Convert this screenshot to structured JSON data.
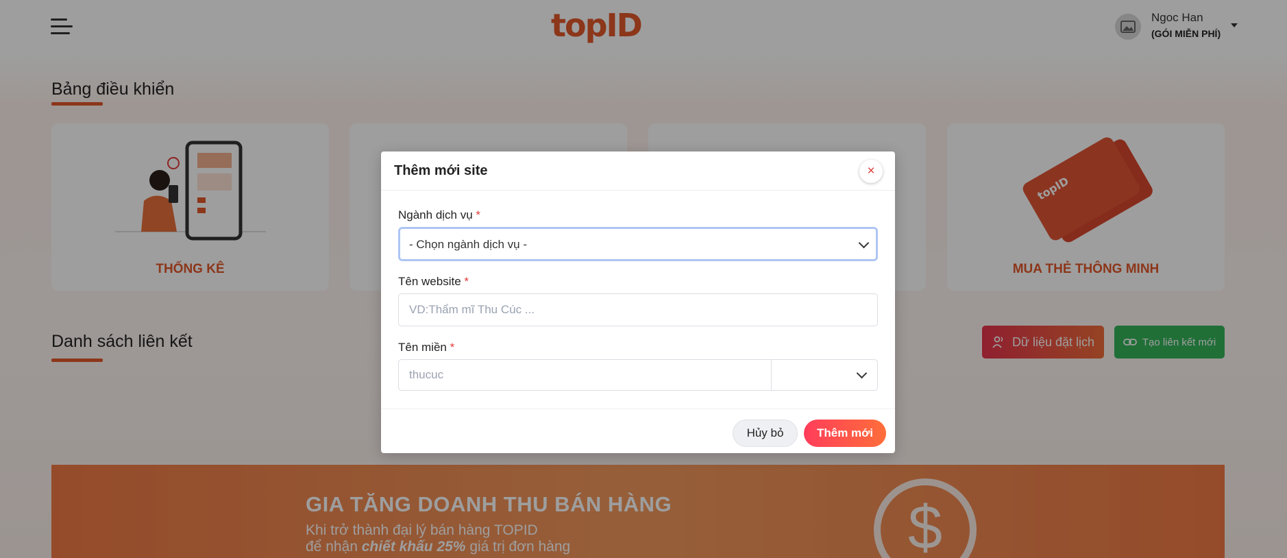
{
  "header": {
    "logo": "topID",
    "user_name": "Ngoc Han",
    "user_plan": "(GÓI MIỄN PHÍ)"
  },
  "dashboard": {
    "title": "Bảng điều khiển",
    "cards": [
      {
        "label": "THỐNG KÊ"
      },
      {
        "label": ""
      },
      {
        "label": ""
      },
      {
        "label": "MUA THẺ THÔNG MINH"
      }
    ]
  },
  "links": {
    "title": "Danh sách liên kết",
    "booking_button": "Dữ liệu đặt lịch",
    "new_link_button": "Tạo liên kết mới"
  },
  "banner": {
    "title": "GIA TĂNG DOANH THU BÁN HÀNG",
    "line1": "Khi trở thành đại lý bán hàng TOPID",
    "line2_prefix": "để nhận ",
    "line2_bold": "chiết khấu 25%",
    "line2_suffix": " giá trị đơn hàng",
    "card_logo": "topID"
  },
  "modal": {
    "title": "Thêm mới site",
    "close_symbol": "×",
    "required_mark": "*",
    "service": {
      "label": "Ngành dịch vụ",
      "value": "- Chọn ngành dịch vụ -"
    },
    "website": {
      "label": "Tên website",
      "placeholder": "VD:Thẩm mĩ Thu Cúc ..."
    },
    "domain": {
      "label": "Tên miền",
      "placeholder": "thucuc",
      "suffix_value": ""
    },
    "cancel_button": "Hủy bỏ",
    "submit_button": "Thêm mới"
  },
  "colors": {
    "brand": "#e2572a",
    "danger": "#e23b3b",
    "success": "#35b45a",
    "focus": "#aec5f3"
  },
  "icons": [
    "hamburger-icon",
    "image-placeholder-icon",
    "caret-down-icon",
    "users-icon",
    "link-icon",
    "close-icon",
    "chevron-down-icon"
  ]
}
